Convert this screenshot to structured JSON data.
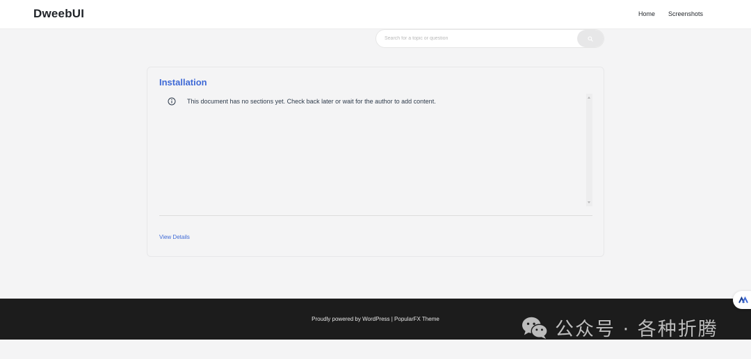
{
  "header": {
    "brand": "DweebUI",
    "nav": [
      {
        "label": "Home"
      },
      {
        "label": "Screenshots"
      }
    ]
  },
  "search": {
    "placeholder": "Search for a topic or question",
    "icon": "search-icon"
  },
  "card": {
    "title": "Installation",
    "notice_icon": "info-icon",
    "notice_text": "This document has no sections yet. Check back later or wait for the author to add content.",
    "link_label": "View Details"
  },
  "footer": {
    "text": "Proudly powered by WordPress | PopularFX Theme"
  },
  "watermark": {
    "text": "公众号 · 各种折腾",
    "icon": "wechat-icon"
  },
  "colors": {
    "accent": "#3e69d6",
    "page_bg": "#f4f4f5",
    "footer_bg": "#1c1c1c",
    "header_bg": "#ffffff"
  }
}
